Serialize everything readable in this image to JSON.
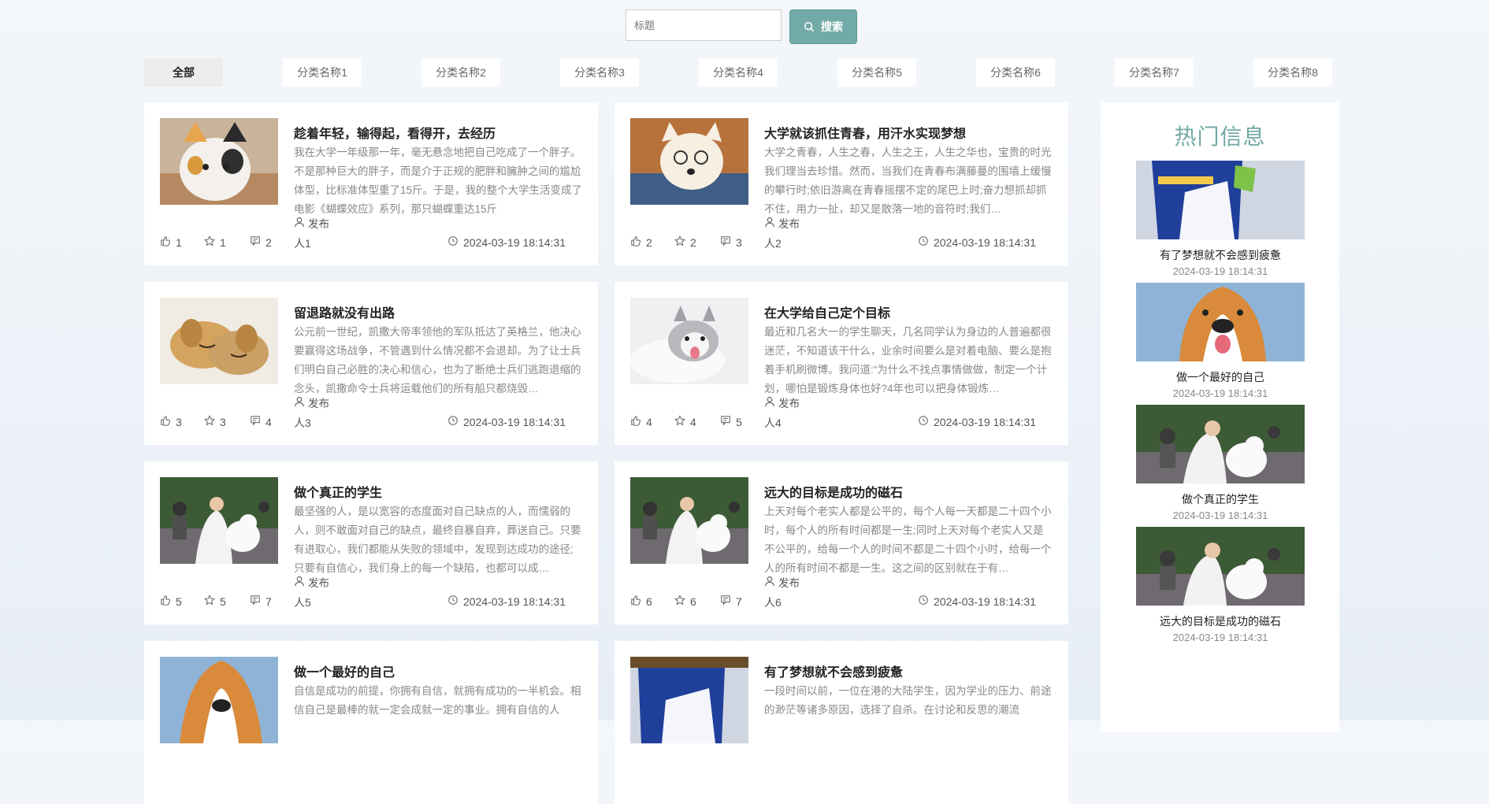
{
  "search": {
    "placeholder": "标题",
    "button": "搜索"
  },
  "categories": [
    "全部",
    "分类名称1",
    "分类名称2",
    "分类名称3",
    "分类名称4",
    "分类名称5",
    "分类名称6",
    "分类名称7",
    "分类名称8"
  ],
  "author_label": "发布",
  "posts": [
    {
      "title": "趁着年轻，输得起，看得开，去经历",
      "body": "我在大学一年级那一年，毫无悬念地把自己吃成了一个胖子。不是那种巨大的胖子，而是介于正规的肥胖和臃肿之间的尴尬体型，比标准体型重了15斤。于是，我的整个大学生活变成了电影《蝴蝶效应》系列，那只蝴蝶重达15斤",
      "likes": "1",
      "favs": "1",
      "comments": "2",
      "user": "人1",
      "date": "2024-03-19 18:14:31"
    },
    {
      "title": "大学就该抓住青春，用汗水实现梦想",
      "body": "大学之青春，人生之春，人生之王，人生之华也，宝贵的时光我们理当去珍惜。然而，当我们在青春布满藤蔓的围墙上缓慢的攀行时;依旧游离在青春摇摆不定的尾巴上时;奋力想抓却抓不住，用力一扯，却又是散落一地的音符时;我们…",
      "likes": "2",
      "favs": "2",
      "comments": "3",
      "user": "人2",
      "date": "2024-03-19 18:14:31"
    },
    {
      "title": "留退路就没有出路",
      "body": "公元前一世纪，凯撒大帝率领他的军队抵达了英格兰，他决心要赢得这场战争，不管遇到什么情况都不会退却。为了让士兵们明白自己必胜的决心和信心，也为了断绝士兵们逃跑退缩的念头，凯撒命令士兵将运载他们的所有船只都烧毁…",
      "likes": "3",
      "favs": "3",
      "comments": "4",
      "user": "人3",
      "date": "2024-03-19 18:14:31"
    },
    {
      "title": "在大学给自己定个目标",
      "body": "最近和几名大一的学生聊天，几名同学认为身边的人普遍都很迷茫，不知道该干什么，业余时间要么是对着电脑、要么是抱着手机刷微博。我问道:“为什么不找点事情做做，制定一个计划，哪怕是锻炼身体也好?4年也可以把身体锻炼…",
      "likes": "4",
      "favs": "4",
      "comments": "5",
      "user": "人4",
      "date": "2024-03-19 18:14:31"
    },
    {
      "title": "做个真正的学生",
      "body": "最坚强的人，是以宽容的态度面对自己缺点的人，而懦弱的人，则不敢面对自己的缺点，最终自暴自弃，葬送自己。只要有进取心，我们都能从失败的领域中，发现到达成功的途径;只要有自信心，我们身上的每一个缺陷，也都可以成…",
      "likes": "5",
      "favs": "5",
      "comments": "7",
      "user": "人5",
      "date": "2024-03-19 18:14:31"
    },
    {
      "title": "远大的目标是成功的磁石",
      "body": "上天对每个老实人都是公平的，每个人每一天都是二十四个小时，每个人的所有时间都是一生;同时上天对每个老实人又是不公平的，给每一个人的时间不都是二十四个小时，给每一个人的所有时间不都是一生。这之间的区别就在于有…",
      "likes": "6",
      "favs": "6",
      "comments": "7",
      "user": "人6",
      "date": "2024-03-19 18:14:31"
    },
    {
      "title": "做一个最好的自己",
      "body": "自信是成功的前提，你拥有自信，就拥有成功的一半机会。相信自己是最棒的就一定会成就一定的事业。拥有自信的人",
      "likes": "",
      "favs": "",
      "comments": "",
      "user": "",
      "date": ""
    },
    {
      "title": "有了梦想就不会感到疲惫",
      "body": "一段时间以前，一位在港的大陆学生，因为学业的压力、前途的渺茫等诸多原因，选择了自杀。在讨论和反思的潮流",
      "likes": "",
      "favs": "",
      "comments": "",
      "user": "",
      "date": ""
    }
  ],
  "hot": {
    "title": "热门信息",
    "items": [
      {
        "title": "有了梦想就不会感到疲惫",
        "date": "2024-03-19 18:14:31"
      },
      {
        "title": "做一个最好的自己",
        "date": "2024-03-19 18:14:31"
      },
      {
        "title": "做个真正的学生",
        "date": "2024-03-19 18:14:31"
      },
      {
        "title": "远大的目标是成功的磁石",
        "date": "2024-03-19 18:14:31"
      }
    ]
  },
  "colors": {
    "accent": "#71aaa6",
    "card": "#ffffff",
    "tab_active": "#ececec"
  }
}
